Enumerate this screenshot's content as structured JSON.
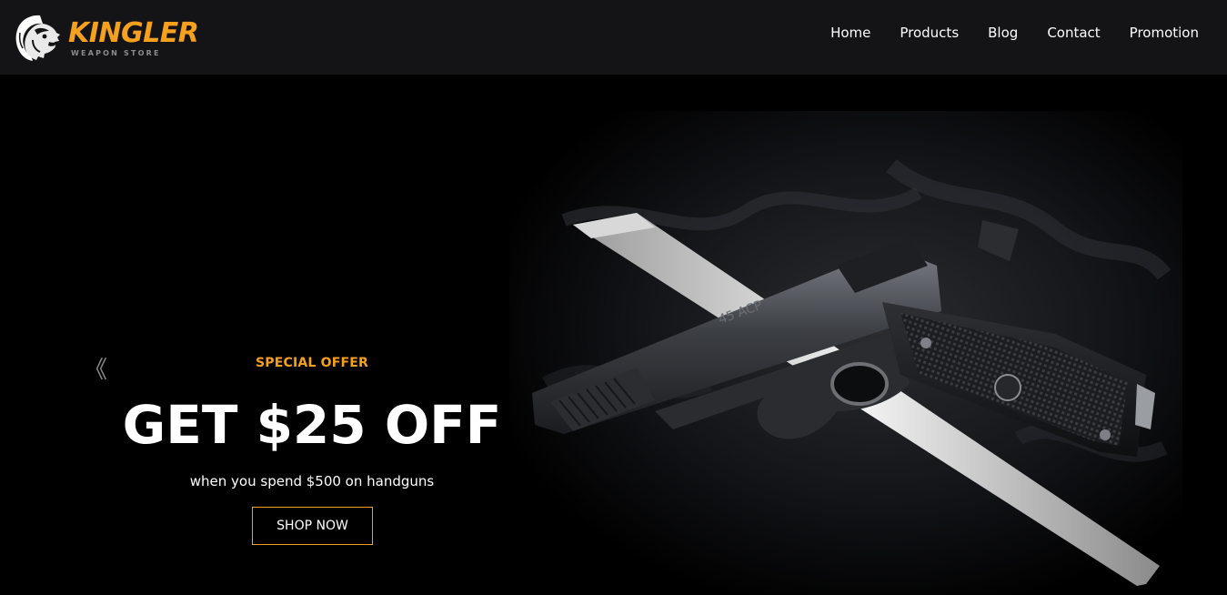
{
  "header": {
    "brand_name": "KINGLER",
    "brand_tagline": "WEAPON STORE",
    "logo_icon": "lion-head-icon",
    "nav": [
      {
        "label": "Home"
      },
      {
        "label": "Products"
      },
      {
        "label": "Blog"
      },
      {
        "label": "Contact"
      },
      {
        "label": "Promotion"
      }
    ]
  },
  "hero": {
    "prev_arrow": "《",
    "offer_label": "SPECIAL OFFER",
    "headline": "GET $25 OFF",
    "subline": "when you spend $500 on handguns",
    "cta_label": "SHOP NOW",
    "image_subject": "pistol and knife on dark cloth"
  },
  "colors": {
    "accent": "#f6a11d",
    "header_bg": "#141416",
    "hero_bg": "#000000"
  }
}
